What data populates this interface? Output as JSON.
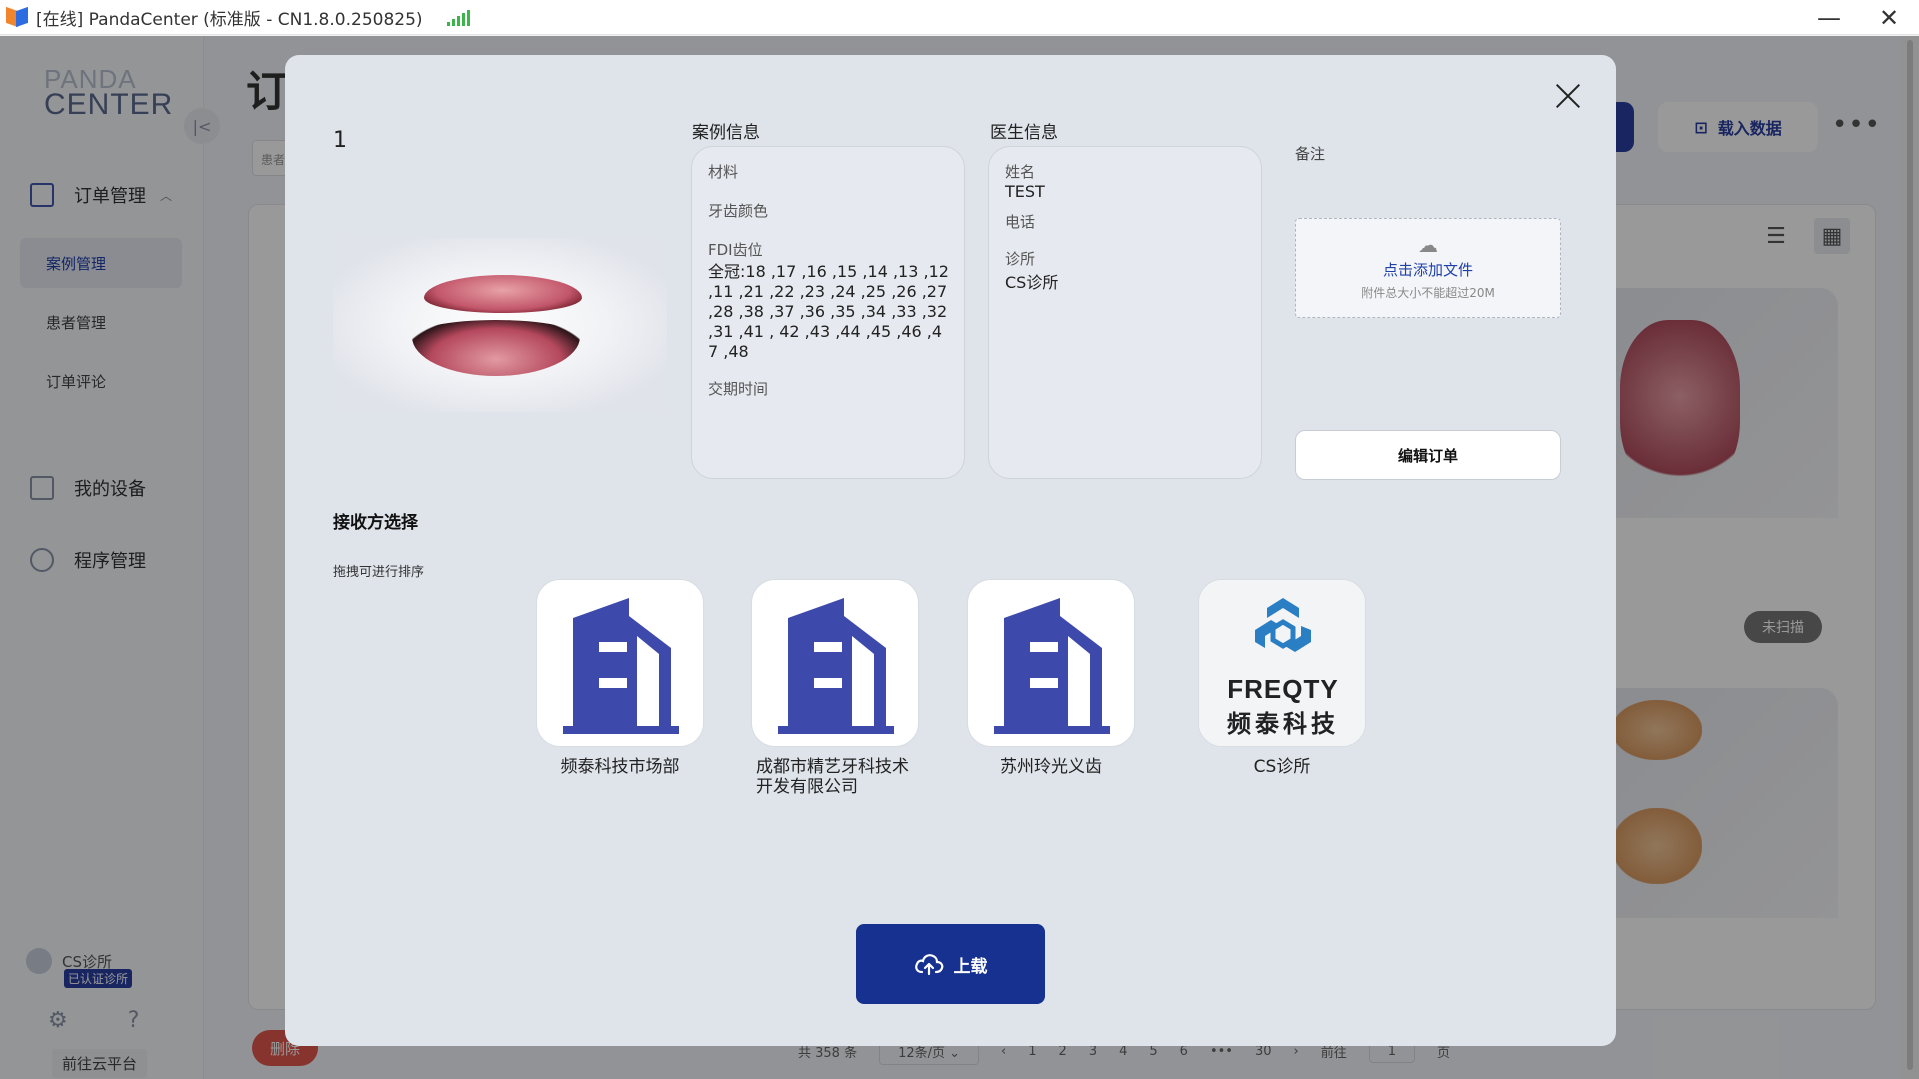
{
  "window": {
    "title": "[在线] PandaCenter (标准版 - CN1.8.0.250825)",
    "minimize_glyph": "—",
    "close_glyph": "✕"
  },
  "sidebar": {
    "brand_top": "PANDA",
    "brand_bottom": "CENTER",
    "groups": [
      {
        "label": "订单管理",
        "icon": "order-icon"
      },
      {
        "label": "我的设备",
        "icon": "device-icon"
      },
      {
        "label": "程序管理",
        "icon": "program-icon"
      }
    ],
    "sub_items": [
      "案例管理",
      "患者管理",
      "订单评论"
    ],
    "user": {
      "name": "CS诊所",
      "badge": "已认证诊所"
    },
    "cloud_link": "前往云平台"
  },
  "background": {
    "page_title": "订",
    "search_placeholder": "患者",
    "load_data_label": "载入数据",
    "unscanned_badge": "未扫描",
    "delete_label": "删除",
    "pager": {
      "total": "共 358 条",
      "per_page": "12条/页",
      "pages": [
        "1",
        "2",
        "3",
        "4",
        "5",
        "6",
        "•••",
        "30"
      ],
      "goto_label": "前往",
      "goto_value": "1",
      "page_suffix": "页"
    }
  },
  "modal": {
    "case_number": "1",
    "case_info": {
      "title": "案例信息",
      "material_label": "材料",
      "tooth_color_label": "牙齿颜色",
      "fdi_label": "FDI齿位",
      "fdi_value": "全冠:18 ,17 ,16 ,15 ,14 ,13 ,12 ,11 ,21 ,22 ,23 ,24 ,25 ,26 ,27 ,28 ,38 ,37 ,36 ,35 ,34 ,33 ,32 ,31 ,41 , 42 ,43 ,44 ,45 ,46 ,47 ,48",
      "delivery_label": "交期时间"
    },
    "doctor_info": {
      "title": "医生信息",
      "name_label": "姓名",
      "name_value": "TEST",
      "phone_label": "电话",
      "clinic_label": "诊所",
      "clinic_value": "CS诊所"
    },
    "remark_label": "备注",
    "upload_zone": {
      "title": "点击添加文件",
      "hint": "附件总大小不能超过20M"
    },
    "edit_order_label": "编辑订单",
    "receiver": {
      "title": "接收方选择",
      "hint": "拖拽可进行排序",
      "items": [
        {
          "name": "频泰科技市场部",
          "icon": "building-icon"
        },
        {
          "name": "成都市精艺牙科技术开发有限公司",
          "icon": "building-icon"
        },
        {
          "name": "苏州玲光义齿",
          "icon": "building-icon"
        },
        {
          "name": "CS诊所",
          "icon": "freqty-logo"
        }
      ],
      "freqty_logo_en": "FREQTY",
      "freqty_logo_cn": "频泰科技"
    },
    "upload_button_label": "上载"
  },
  "colors": {
    "primary": "#16318f",
    "building": "#3e4aab",
    "danger": "#e0574b",
    "logo_teal": "#2a7fc4"
  }
}
